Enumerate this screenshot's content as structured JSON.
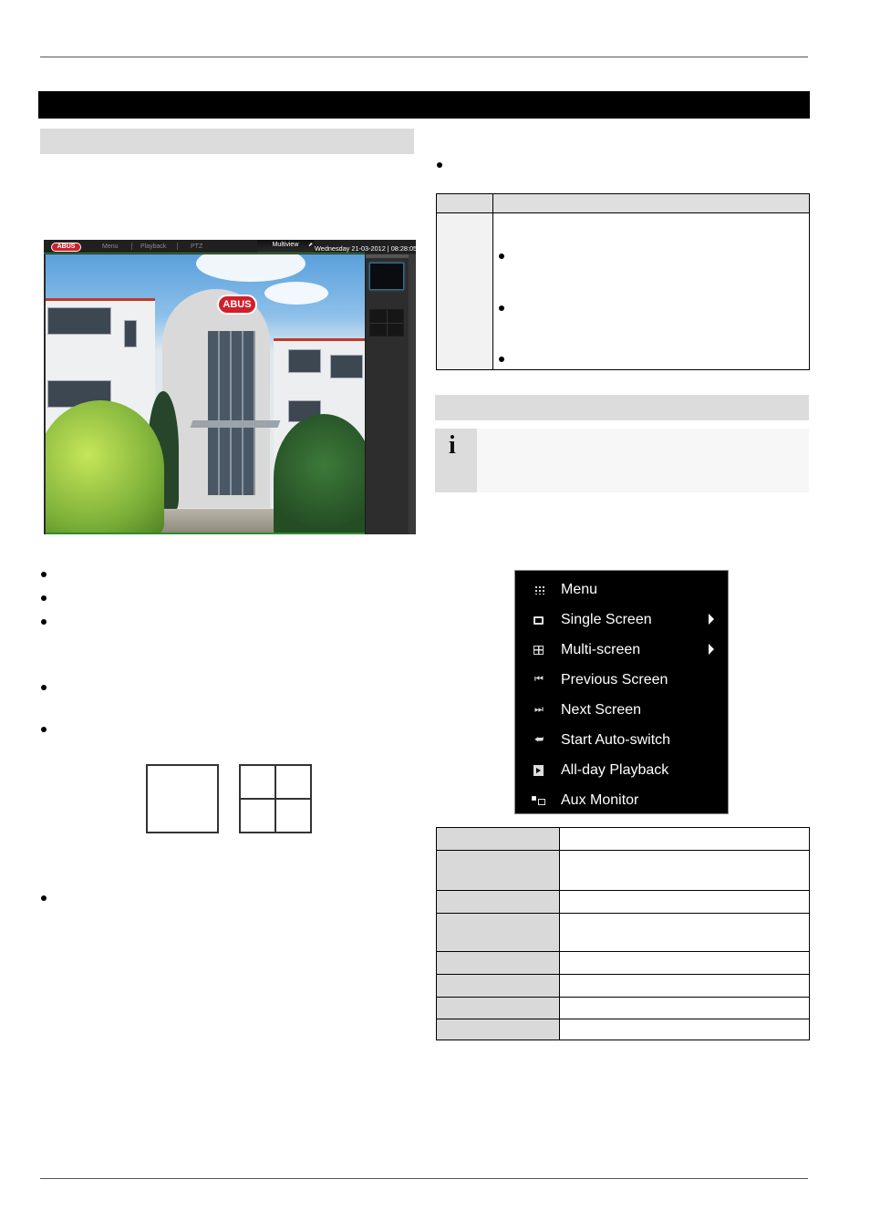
{
  "document": {
    "chapter_title": "",
    "left_section_title": "",
    "right_section_title": "",
    "info_note": "",
    "info_icon": "info-icon"
  },
  "live_view": {
    "brand_logo": "ABUS",
    "nav": [
      "Menu",
      "Playback",
      "PTZ"
    ],
    "multiview_label": "Multiview",
    "datetime": "Wednesday 21-03-2012 | 08:28:05",
    "building_sign": "ABUS",
    "side_panel_title": "",
    "layouts": [
      {
        "name": "single-screen-layout",
        "selected": true
      },
      {
        "name": "quad-screen-layout",
        "selected": false
      }
    ]
  },
  "left_bullets": [
    "",
    "",
    "",
    "",
    "",
    ""
  ],
  "layout_icons": [
    {
      "name": "single-screen",
      "cells": 1
    },
    {
      "name": "quad-screen",
      "cells": 4
    }
  ],
  "table1": {
    "headers": [
      "",
      ""
    ],
    "rows": [
      {
        "key": "",
        "intro": "",
        "bullets": [
          "",
          "",
          ""
        ]
      }
    ]
  },
  "right_intro_bullet": "",
  "osd_menu": {
    "items": [
      {
        "label": "Menu",
        "icon": "menu-grid-icon",
        "submenu": false
      },
      {
        "label": "Single Screen",
        "icon": "single-screen-icon",
        "submenu": true
      },
      {
        "label": "Multi-screen",
        "icon": "multi-screen-icon",
        "submenu": true
      },
      {
        "label": "Previous Screen",
        "icon": "previous-screen-icon",
        "submenu": false
      },
      {
        "label": "Next Screen",
        "icon": "next-screen-icon",
        "submenu": false
      },
      {
        "label": "Start Auto-switch",
        "icon": "auto-switch-icon",
        "submenu": false
      },
      {
        "label": "All-day Playback",
        "icon": "all-day-playback-icon",
        "submenu": false
      },
      {
        "label": "Aux Monitor",
        "icon": "aux-monitor-icon",
        "submenu": false
      }
    ]
  },
  "table2": {
    "rows": [
      {
        "key": "",
        "value": ""
      },
      {
        "key": "",
        "value": ""
      },
      {
        "key": "",
        "value": ""
      },
      {
        "key": "",
        "value": ""
      },
      {
        "key": "",
        "value": ""
      },
      {
        "key": "",
        "value": ""
      },
      {
        "key": "",
        "value": ""
      },
      {
        "key": "",
        "value": ""
      }
    ]
  }
}
